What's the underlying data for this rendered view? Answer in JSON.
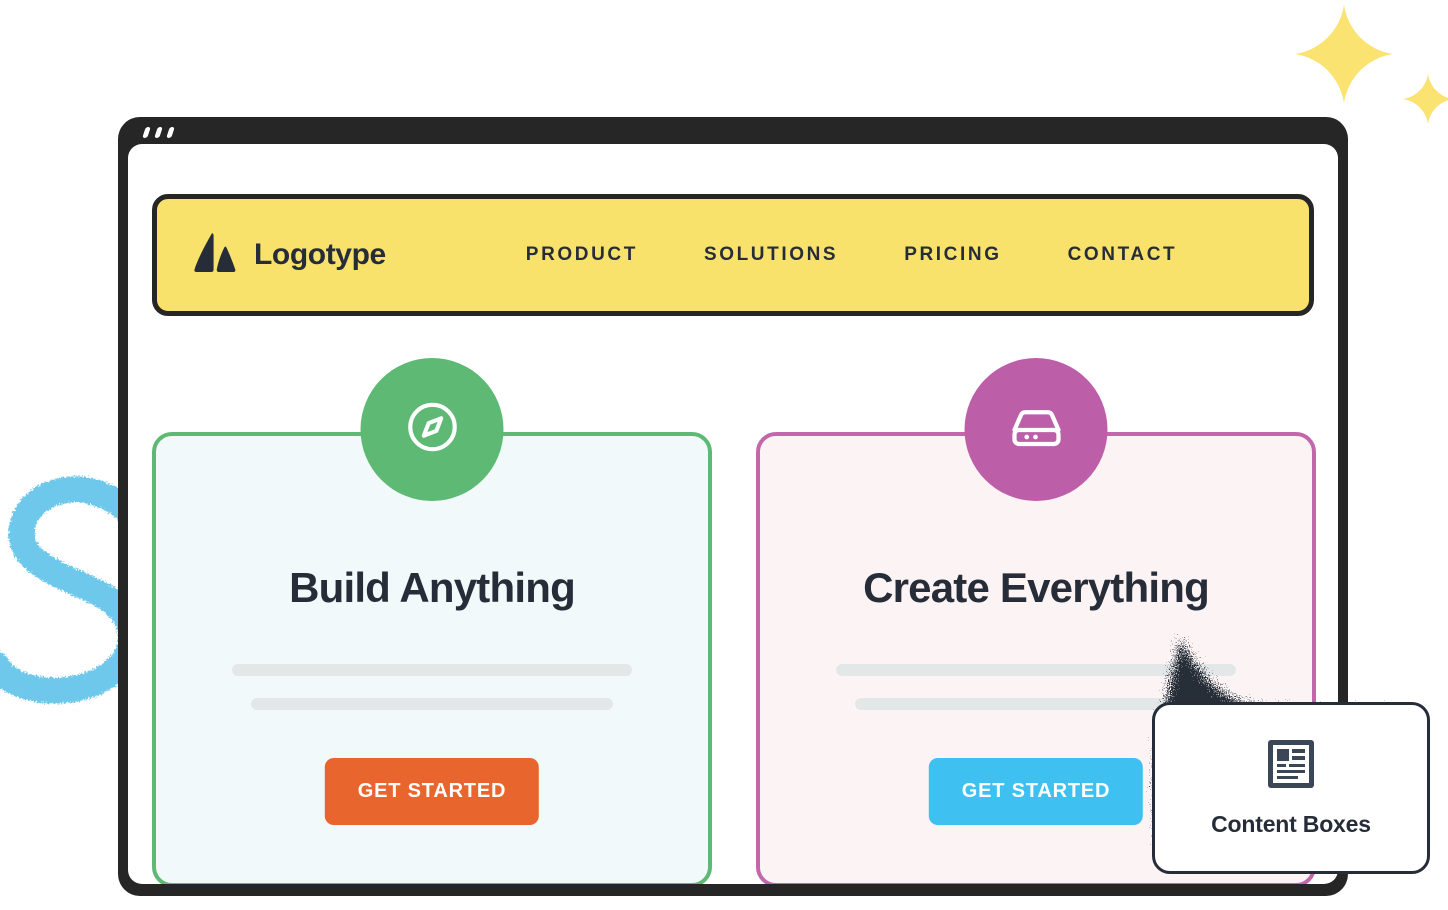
{
  "window": {
    "titlebar_dots": [
      "dot-1",
      "dot-2",
      "dot-3"
    ]
  },
  "navbar": {
    "brand": {
      "logo_icon": "triangle-logo-mark",
      "name": "Logotype"
    },
    "links": [
      {
        "label": "PRODUCT"
      },
      {
        "label": "SOLUTIONS"
      },
      {
        "label": "PRICING"
      },
      {
        "label": "CONTACT"
      }
    ],
    "background_color": "#F9E26C",
    "border_color": "#262626"
  },
  "cards": [
    {
      "icon": "compass-icon",
      "title": "Build Anything",
      "cta_label": "GET STARTED",
      "accent_color": "#5DB974",
      "background_color": "#F2F9FA",
      "badge_color": "#5DB974",
      "cta_color": "#E8662E"
    },
    {
      "icon": "hard-drive-icon",
      "title": "Create Everything",
      "cta_label": "GET STARTED",
      "accent_color": "#C367AC",
      "background_color": "#FCF4F4",
      "badge_color": "#BD5FA8",
      "cta_color": "#3EC1F0"
    }
  ],
  "callout": {
    "icon": "content-layout-icon",
    "label": "Content Boxes",
    "border_color": "#262D38"
  },
  "decorations": {
    "sparkle_color": "#FBE372",
    "squiggle_color": "#6DC8EB",
    "splash_color": "#262D38"
  }
}
